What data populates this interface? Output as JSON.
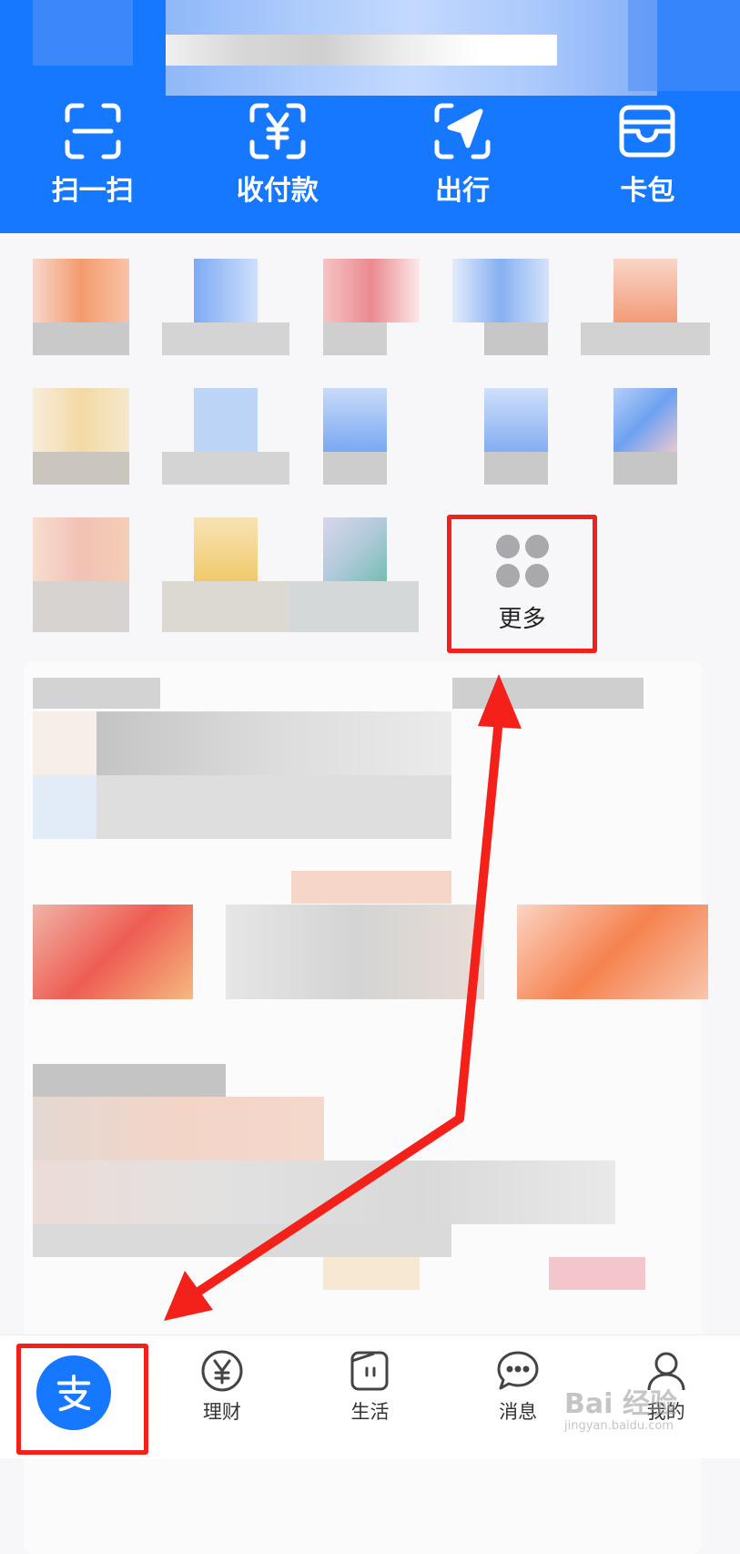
{
  "quick_actions": [
    {
      "label": "扫一扫",
      "icon": "scan-icon"
    },
    {
      "label": "收付款",
      "icon": "payment-code-icon"
    },
    {
      "label": "出行",
      "icon": "travel-icon"
    },
    {
      "label": "卡包",
      "icon": "wallet-icon"
    }
  ],
  "more": {
    "label": "更多",
    "icon": "more-grid-icon"
  },
  "tabbar": {
    "tabs": [
      {
        "label": "",
        "icon": "alipay-home-icon"
      },
      {
        "label": "理财",
        "icon": "yuan-circle-icon"
      },
      {
        "label": "生活",
        "icon": "life-icon"
      },
      {
        "label": "消息",
        "icon": "message-bubble-icon"
      },
      {
        "label": "我的",
        "icon": "person-icon"
      }
    ]
  },
  "watermark": {
    "line1": "Bai 经验",
    "line2": "jingyan.baidu.com"
  },
  "colors": {
    "brand_blue": "#1677ff",
    "annotation_red": "#f4211a",
    "background": "#f7f7f9"
  }
}
